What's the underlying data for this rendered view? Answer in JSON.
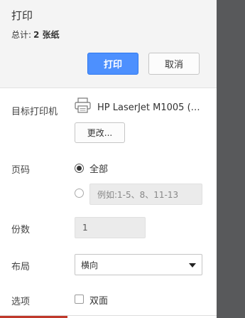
{
  "header": {
    "title": "打印",
    "total_label": "总计:",
    "total_value": "2 张纸",
    "print_label": "打印",
    "cancel_label": "取消"
  },
  "destination": {
    "label": "目标打印机",
    "printer_name": "HP LaserJet M1005 (副...",
    "change_label": "更改..."
  },
  "pages": {
    "label": "页码",
    "all_label": "全部",
    "range_placeholder": "例如:1-5、8、11-13"
  },
  "copies": {
    "label": "份数",
    "value": "1"
  },
  "layout": {
    "label": "布局",
    "selected": "横向"
  },
  "options": {
    "label": "选项",
    "duplex_label": "双面"
  },
  "colors": {
    "accent": "#4d90fe",
    "shade": "#58595b"
  }
}
